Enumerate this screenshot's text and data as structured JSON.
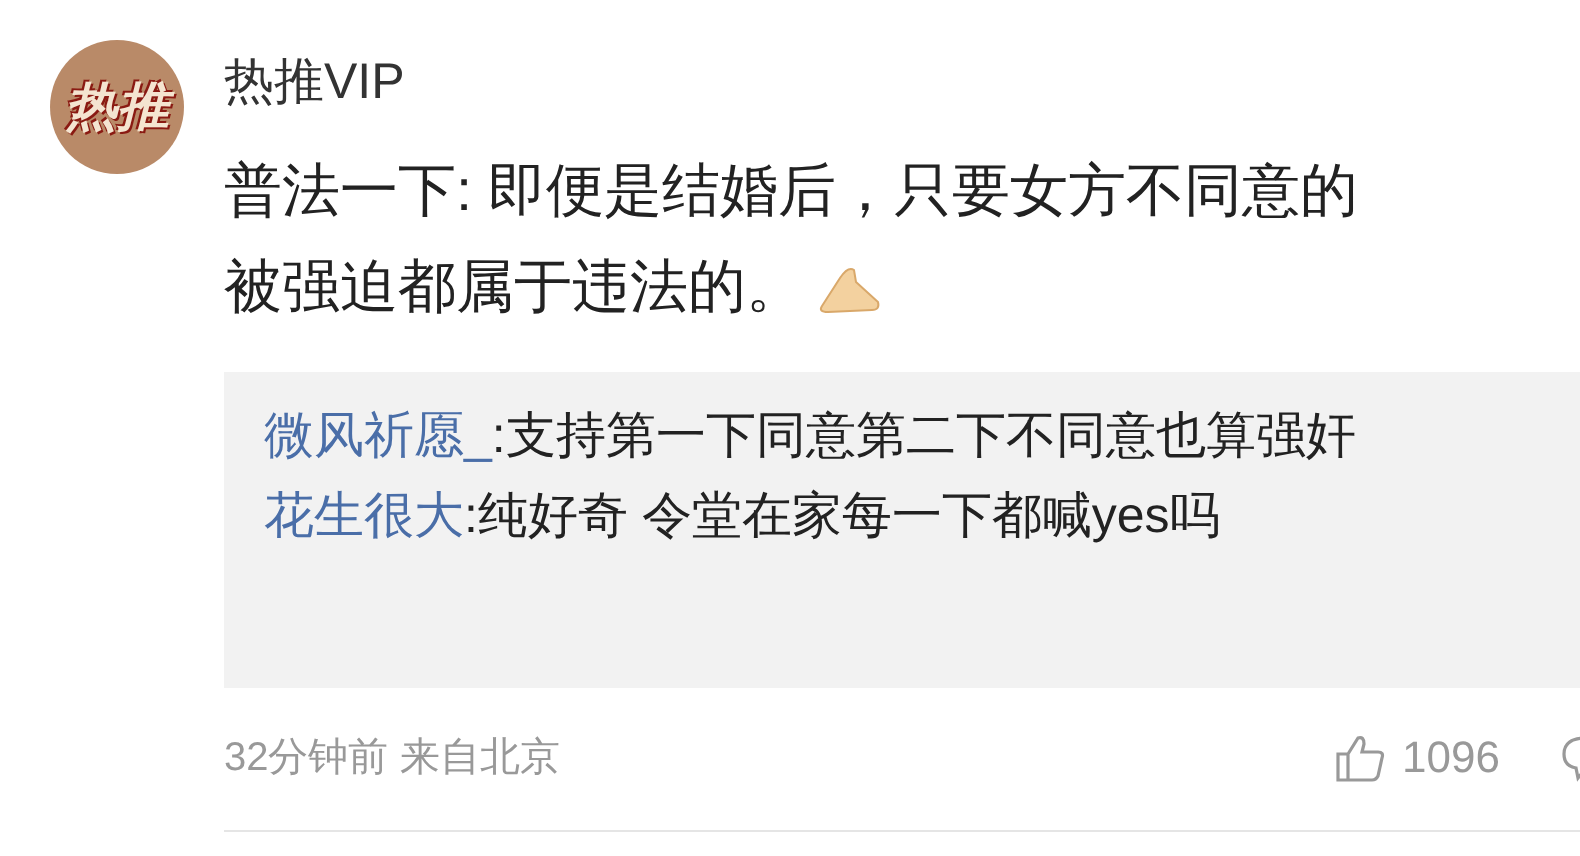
{
  "avatar": {
    "text": "热推"
  },
  "author": "热推VIP",
  "body": [
    "普法一下: 即便是结婚后，只要女方不同意的",
    "被强迫都属于违法的。"
  ],
  "replies": [
    {
      "user": "微风祈愿_",
      "text": ":支持第一下同意第二下不同意也算强奸"
    },
    {
      "user": "花生很大",
      "text": ":纯好奇 令堂在家每一下都喊yes吗"
    }
  ],
  "meta": "32分钟前 来自北京",
  "likes": "1096"
}
